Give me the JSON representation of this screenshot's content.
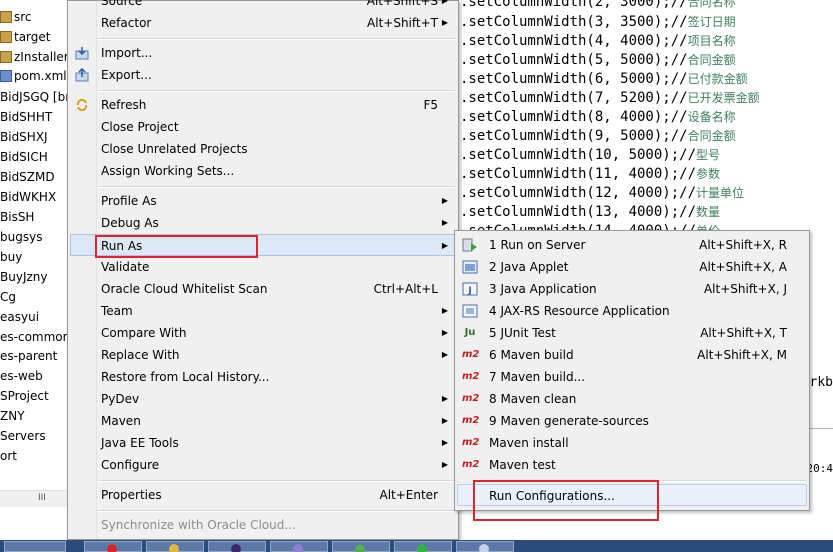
{
  "project_tree": {
    "items": [
      "src",
      "target",
      "zInstaller",
      "pom.xml",
      "BidJSGQ [br",
      "BidSHHT",
      "BidSHXJ",
      "BidSICH",
      "BidSZMD",
      "BidWKHX",
      "BisSH",
      "bugsys",
      "buy",
      "BuyJzny",
      "Cg",
      "easyui",
      "es-common",
      "es-parent",
      "es-web",
      "SProject",
      "ZNY",
      "Servers",
      "ort"
    ],
    "scroll_grip": "III"
  },
  "editor": {
    "lines": [
      {
        "code": ".setColumnWidth(2, 3000);//",
        "comment": "合同名称"
      },
      {
        "code": ".setColumnWidth(3, 3500);//",
        "comment": "签订日期"
      },
      {
        "code": ".setColumnWidth(4, 4000);//",
        "comment": "项目名称"
      },
      {
        "code": ".setColumnWidth(5, 5000);//",
        "comment": "合同金额"
      },
      {
        "code": ".setColumnWidth(6, 5000);//",
        "comment": "已付款金额"
      },
      {
        "code": ".setColumnWidth(7, 5200);//",
        "comment": "已开发票金额"
      },
      {
        "code": ".setColumnWidth(8, 4000);//",
        "comment": "设备名称"
      },
      {
        "code": ".setColumnWidth(9, 5000);//",
        "comment": "合同金额"
      },
      {
        "code": ".setColumnWidth(10, 5000);//",
        "comment": "型号"
      },
      {
        "code": ".setColumnWidth(11, 4000);//",
        "comment": "参数"
      },
      {
        "code": ".setColumnWidth(12, 4000);//",
        "comment": "计量单位"
      },
      {
        "code": ".setColumnWidth(13, 4000);//",
        "comment": "数量"
      },
      {
        "code": ".setColumnWidth(14, 4000);//",
        "comment": "单价"
      }
    ],
    "fragment_right": "orkb",
    "fragment_time": ":20:4"
  },
  "context_menu": {
    "items": [
      {
        "label": "Source",
        "shortcut": "Alt+Shift+S",
        "arrow": true
      },
      {
        "label": "Refactor",
        "shortcut": "Alt+Shift+T",
        "arrow": true
      },
      {
        "label": "Import...",
        "icon": "import-icon"
      },
      {
        "label": "Export...",
        "icon": "export-icon"
      },
      {
        "label": "Refresh",
        "shortcut": "F5",
        "icon": "refresh-icon"
      },
      {
        "label": "Close Project"
      },
      {
        "label": "Close Unrelated Projects"
      },
      {
        "label": "Assign Working Sets..."
      },
      {
        "label": "Profile As",
        "arrow": true
      },
      {
        "label": "Debug As",
        "arrow": true
      },
      {
        "label": "Run As",
        "arrow": true
      },
      {
        "label": "Validate"
      },
      {
        "label": "Oracle Cloud Whitelist Scan",
        "shortcut": "Ctrl+Alt+L"
      },
      {
        "label": "Team",
        "arrow": true
      },
      {
        "label": "Compare With",
        "arrow": true
      },
      {
        "label": "Replace With",
        "arrow": true
      },
      {
        "label": "Restore from Local History..."
      },
      {
        "label": "PyDev",
        "arrow": true
      },
      {
        "label": "Maven",
        "arrow": true
      },
      {
        "label": "Java EE Tools",
        "arrow": true
      },
      {
        "label": "Configure",
        "arrow": true
      },
      {
        "label": "Properties",
        "shortcut": "Alt+Enter"
      },
      {
        "label": "Synchronize with Oracle Cloud..."
      }
    ]
  },
  "run_as_submenu": {
    "items": [
      {
        "label": "1 Run on Server",
        "shortcut": "Alt+Shift+X, R",
        "icon": "run-server-icon"
      },
      {
        "label": "2 Java Applet",
        "shortcut": "Alt+Shift+X, A",
        "icon": "java-applet-icon"
      },
      {
        "label": "3 Java Application",
        "shortcut": "Alt+Shift+X, J",
        "icon": "java-application-icon"
      },
      {
        "label": "4 JAX-RS Resource Application",
        "shortcut": "",
        "icon": "jaxrs-icon"
      },
      {
        "label": "5 JUnit Test",
        "shortcut": "Alt+Shift+X, T",
        "icon": "junit-icon",
        "icon_text": "Ju"
      },
      {
        "label": "6 Maven build",
        "shortcut": "Alt+Shift+X, M",
        "icon": "maven-icon",
        "icon_text": "m2"
      },
      {
        "label": "7 Maven build...",
        "shortcut": "",
        "icon": "maven-icon",
        "icon_text": "m2"
      },
      {
        "label": "8 Maven clean",
        "shortcut": "",
        "icon": "maven-icon",
        "icon_text": "m2"
      },
      {
        "label": "9 Maven generate-sources",
        "shortcut": "",
        "icon": "maven-icon",
        "icon_text": "m2"
      },
      {
        "label": "Maven install",
        "shortcut": "",
        "icon": "maven-icon",
        "icon_text": "m2"
      },
      {
        "label": "Maven test",
        "shortcut": "",
        "icon": "maven-icon",
        "icon_text": "m2"
      },
      {
        "label": "Run Configurations...",
        "shortcut": ""
      }
    ]
  },
  "colors": {
    "highlight_box": "#e3232c",
    "comment": "#3f7f5f",
    "maven": "#c21d24"
  }
}
